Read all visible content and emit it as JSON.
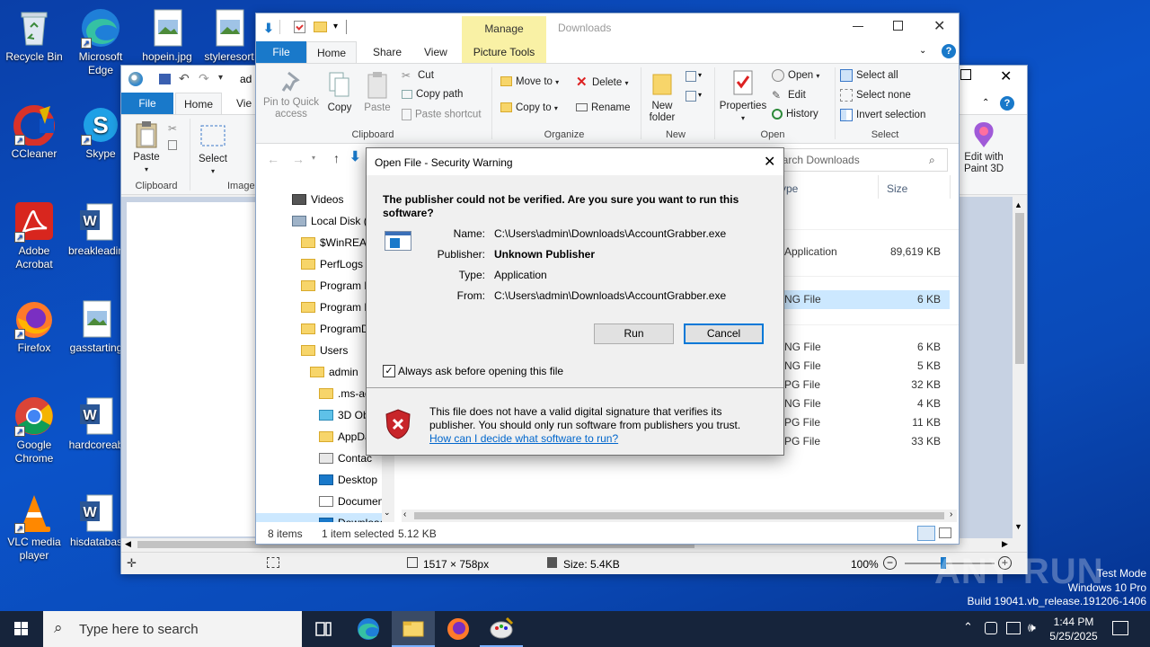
{
  "desktop": {
    "icons": [
      {
        "label": "Recycle Bin",
        "icon": "recycle-bin-icon"
      },
      {
        "label": "Microsoft Edge",
        "icon": "edge-icon"
      },
      {
        "label": "hopein.jpg",
        "icon": "image-file-icon"
      },
      {
        "label": "styleresort",
        "icon": "image-file-icon"
      },
      {
        "label": "CCleaner",
        "icon": "ccleaner-icon"
      },
      {
        "label": "Skype",
        "icon": "skype-icon"
      },
      {
        "label": "Adobe Acrobat",
        "icon": "acrobat-icon"
      },
      {
        "label": "breakleadin",
        "icon": "word-doc-icon"
      },
      {
        "label": "Firefox",
        "icon": "firefox-icon"
      },
      {
        "label": "gasstarting",
        "icon": "image-file-icon"
      },
      {
        "label": "Google Chrome",
        "icon": "chrome-icon"
      },
      {
        "label": "hardcoreab",
        "icon": "word-doc-icon"
      },
      {
        "label": "VLC media player",
        "icon": "vlc-icon"
      },
      {
        "label": "hisdatabas",
        "icon": "word-doc-icon"
      }
    ]
  },
  "back_window": {
    "path_fragment": "ad",
    "tabs": {
      "file": "File",
      "home": "Home",
      "view": "Vie"
    },
    "paste": "Paste",
    "select": "Select",
    "group_clipboard": "Clipboard",
    "group_image": "Image",
    "edit_paint3d": "Edit with Paint 3D",
    "status": {
      "dimensions": "1517 × 758px",
      "size": "Size: 5.4KB",
      "zoom": "100%"
    }
  },
  "explorer": {
    "title": "Downloads",
    "manage_label": "Manage",
    "tabs": {
      "file": "File",
      "home": "Home",
      "share": "Share",
      "view": "View",
      "picture_tools": "Picture Tools"
    },
    "ribbon": {
      "pin": "Pin to Quick access",
      "copy": "Copy",
      "paste": "Paste",
      "cut": "Cut",
      "copy_path": "Copy path",
      "paste_shortcut": "Paste shortcut",
      "move_to": "Move to",
      "copy_to": "Copy to",
      "delete": "Delete",
      "rename": "Rename",
      "new_folder": "New folder",
      "properties": "Properties",
      "open": "Open",
      "edit": "Edit",
      "history": "History",
      "select_all": "Select all",
      "select_none": "Select none",
      "invert_selection": "Invert selection",
      "groups": {
        "clipboard": "Clipboard",
        "organize": "Organize",
        "new": "New",
        "open": "Open",
        "select": "Select"
      }
    },
    "search_placeholder": "earch Downloads",
    "columns": {
      "type": "ype",
      "size": "Size"
    },
    "tree": [
      {
        "label": "Videos",
        "kind": "video-folder"
      },
      {
        "label": "Local Disk (C",
        "kind": "disk"
      },
      {
        "label": "$WinREAg",
        "kind": "folder"
      },
      {
        "label": "PerfLogs",
        "kind": "folder"
      },
      {
        "label": "Program F",
        "kind": "folder"
      },
      {
        "label": "Program F",
        "kind": "folder"
      },
      {
        "label": "ProgramD",
        "kind": "folder"
      },
      {
        "label": "Users",
        "kind": "folder"
      },
      {
        "label": "admin",
        "kind": "folder"
      },
      {
        "label": ".ms-ad",
        "kind": "folder"
      },
      {
        "label": "3D Obje",
        "kind": "3d"
      },
      {
        "label": "AppDat",
        "kind": "folder"
      },
      {
        "label": "Contac",
        "kind": "contacts"
      },
      {
        "label": "Desktop",
        "kind": "desktop"
      },
      {
        "label": "Document",
        "kind": "document"
      },
      {
        "label": "Download",
        "kind": "download"
      }
    ],
    "files": [
      {
        "type": "Application",
        "size": "89,619 KB",
        "selected": false
      },
      {
        "type": "NG File",
        "size": "6 KB",
        "selected": true
      },
      {
        "type": "NG File",
        "size": "6 KB",
        "selected": false
      },
      {
        "type": "NG File",
        "size": "5 KB",
        "selected": false
      },
      {
        "type": "PG File",
        "size": "32 KB",
        "selected": false
      },
      {
        "type": "NG File",
        "size": "4 KB",
        "selected": false
      },
      {
        "type": "PG File",
        "size": "11 KB",
        "selected": false
      },
      {
        "type": "PG File",
        "size": "33 KB",
        "selected": false
      }
    ],
    "status": {
      "items": "8 items",
      "selected": "1 item selected",
      "selected_size": "5.12 KB"
    }
  },
  "dialog": {
    "title": "Open File - Security Warning",
    "heading": "The publisher could not be verified.  Are you sure you want to run this software?",
    "fields": [
      {
        "label": "Name:",
        "value": "C:\\Users\\admin\\Downloads\\AccountGrabber.exe",
        "bold": false
      },
      {
        "label": "Publisher:",
        "value": "Unknown Publisher",
        "bold": true
      },
      {
        "label": "Type:",
        "value": "Application",
        "bold": false
      },
      {
        "label": "From:",
        "value": "C:\\Users\\admin\\Downloads\\AccountGrabber.exe",
        "bold": false
      }
    ],
    "run": "Run",
    "cancel": "Cancel",
    "checkbox_label": "Always ask before opening this file",
    "checkbox_checked": true,
    "warning_text": "This file does not have a valid digital signature that verifies its publisher.  You should only run software from publishers you trust.",
    "help_link": "How can I decide what software to run?"
  },
  "watermark": {
    "brand": "ANY RUN",
    "mode": "Test Mode",
    "edition": "Windows 10 Pro",
    "build": "Build 19041.vb_release.191206-1406"
  },
  "taskbar": {
    "search_placeholder": "Type here to search",
    "time": "1:44 PM",
    "date": "5/25/2025"
  }
}
